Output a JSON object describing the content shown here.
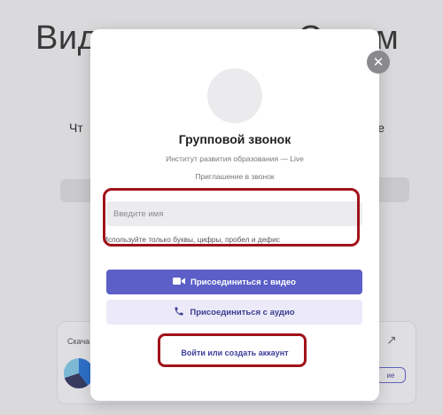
{
  "background": {
    "title_left": "Вид",
    "title_mid": "С",
    "title_right": "ум",
    "subtitle_left": "Чт",
    "subtitle_right": "те",
    "card_label": "Скача",
    "card_button": "ие",
    "arrow_icon": "arrow-up-right-icon"
  },
  "modal": {
    "title": "Групповой звонок",
    "organization": "Институт развития образования — Live",
    "invitation": "Приглашение в звонок",
    "name_input": {
      "placeholder": "Введите имя",
      "value": ""
    },
    "name_hint": "Используйте только буквы, цифры, пробел и дефис",
    "join_video_label": "Присоединиться с видео",
    "join_audio_label": "Присоединиться с аудио",
    "login_label": "Войти или создать аккаунт",
    "close_icon": "close-icon"
  },
  "colors": {
    "primary": "#5b5fc7",
    "secondary_bg": "#eceaf8",
    "highlight": "#a1131b"
  }
}
